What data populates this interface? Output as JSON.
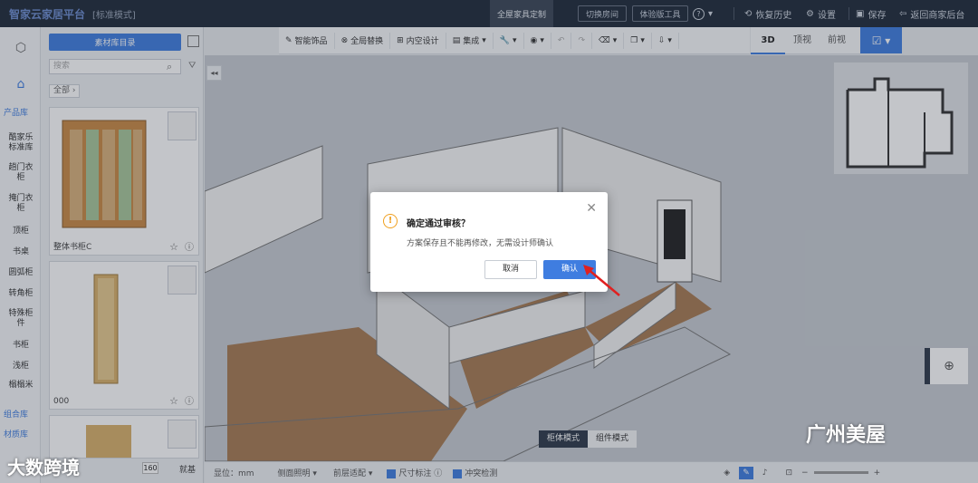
{
  "topbar": {
    "brand": "智家云家居平台",
    "mode": "[标准模式]",
    "active_tab": "全屋家具定制",
    "switch_room": "切换房间",
    "experience": "体验版工具",
    "help": "?",
    "history": "恢复历史",
    "settings": "设置",
    "save": "保存",
    "back": "返回商家后台"
  },
  "rail": {
    "product_library": "产品库",
    "categories": [
      "酷家乐标准库",
      "趟门衣柜",
      "掩门衣柜",
      "顶柜",
      "书桌",
      "圆弧柜",
      "转角柜",
      "特殊柜件",
      "书柜",
      "浅柜",
      "榻榻米"
    ],
    "combo_library": "组合库",
    "material_library": "材质库"
  },
  "library": {
    "button": "素材库目录",
    "search_placeholder": "搜索",
    "breadcrumb": "全部",
    "cards": [
      {
        "name": "整体书柜C"
      },
      {
        "name": "000"
      },
      {
        "name": ""
      }
    ],
    "page_value": "160",
    "page_label": "就基"
  },
  "toolbar": {
    "items": [
      "智能饰品",
      "全局替换",
      "内空设计",
      "集成",
      "",
      "",
      "",
      "",
      "",
      ""
    ]
  },
  "views": {
    "tabs": [
      "3D",
      "顶视",
      "前视"
    ],
    "active": "3D"
  },
  "dialog": {
    "warn_icon": "!",
    "title": "确定通过审核？",
    "message": "方案保存且不能再修改，无需设计师确认",
    "cancel": "取消",
    "confirm": "确认"
  },
  "mode_switch": {
    "cabinet": "柜体模式",
    "component": "组件模式"
  },
  "statusbar": {
    "unit": "显位：mm",
    "side_light": "侧面照明",
    "edge_fit": "前层适配",
    "size_label": "尺寸标注",
    "collision": "冲突检测"
  },
  "watermarks": {
    "left": "大数跨境",
    "right": "广州美屋"
  },
  "colors": {
    "accent": "#3f7de0",
    "topbar": "#1f2a3a",
    "warning": "#f0a020"
  }
}
